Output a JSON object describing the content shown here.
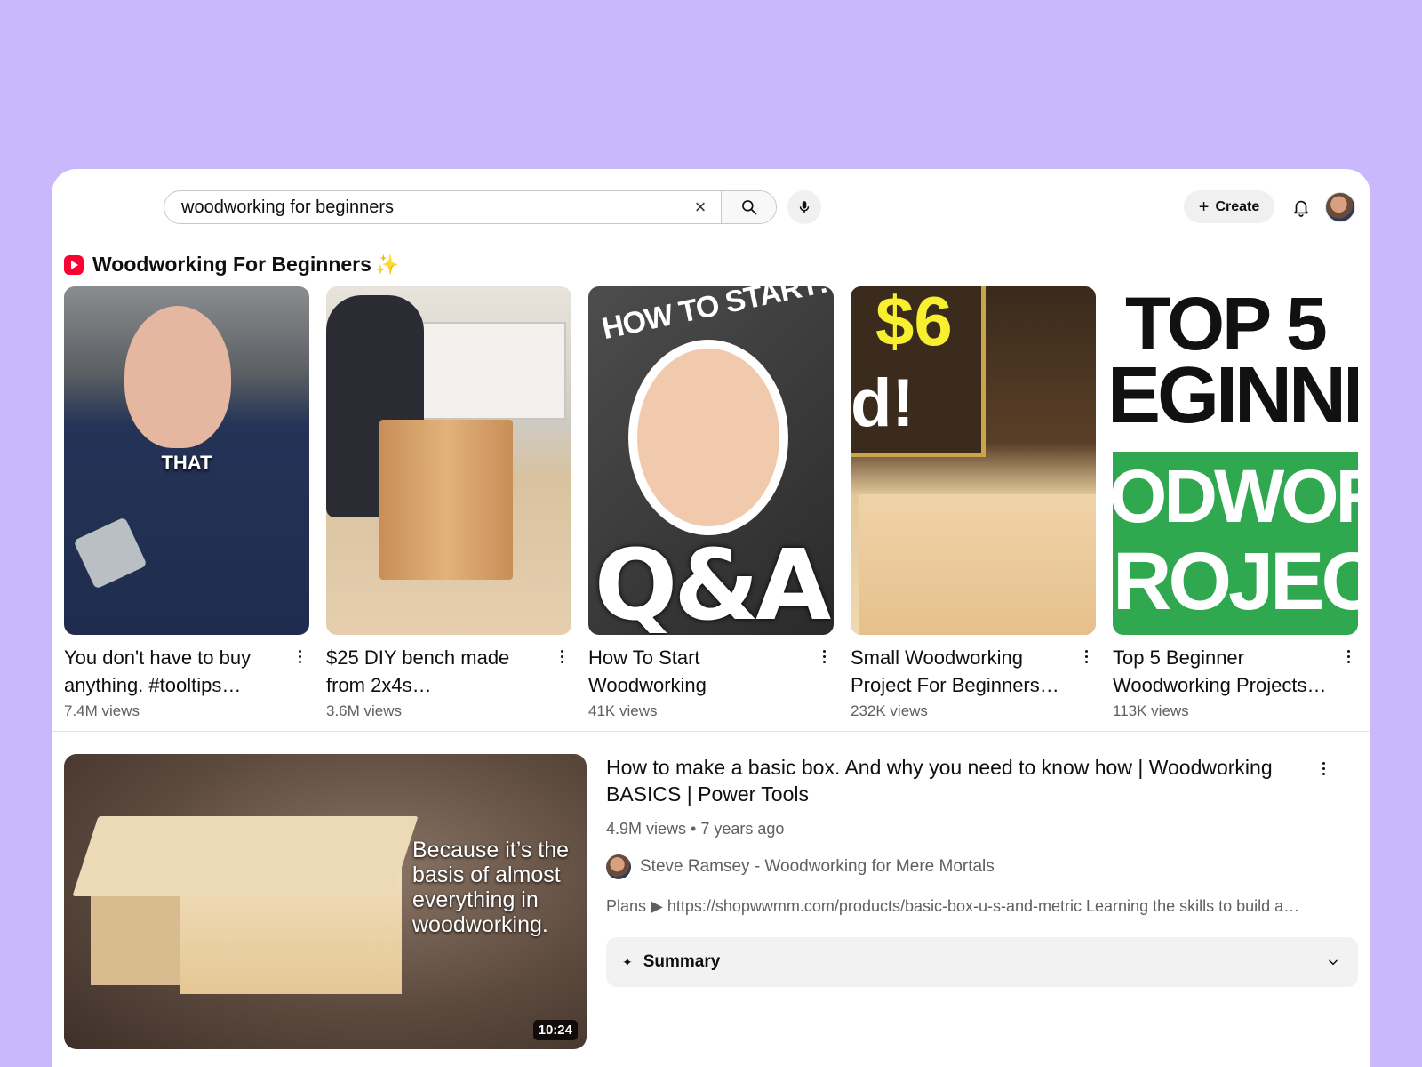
{
  "search": {
    "query": "woodworking for beginners",
    "clear_glyph": "×"
  },
  "header": {
    "create_label": "Create",
    "create_glyph": "+"
  },
  "shorts_section": {
    "title": "Woodworking For Beginners",
    "sparkle": "✨",
    "items": [
      {
        "title": "You don't have to buy anything. #tooltips…",
        "views": "7.4M views",
        "thumb_text": "THAT"
      },
      {
        "title": "$25 DIY bench made from 2x4s…",
        "views": "3.6M views"
      },
      {
        "title": "How To Start Woodworking",
        "views": "41K views",
        "thumb_text": "HOW TO START!",
        "thumb_text_2": "Q&A"
      },
      {
        "title": "Small Woodworking Project For Beginners ~…",
        "views": "232K views",
        "thumb_text": "$6",
        "thumb_text_2": "d!"
      },
      {
        "title": "Top 5 Beginner Woodworking Projects…",
        "views": "113K views",
        "thumb_text": "TOP 5",
        "thumb_text_2": "EGINNI",
        "thumb_text_3": "ODWORK",
        "thumb_text_4": "ROJECTS"
      }
    ]
  },
  "video": {
    "title": "How to make a basic box. And why you need to know how | Woodworking BASICS | Power Tools",
    "meta": "4.9M views • 7 years ago",
    "channel": "Steve Ramsey - Woodworking for Mere Mortals",
    "description": "Plans ▶ https://shopwwmm.com/products/basic-box-u-s-and-metric Learning the skills to build a…",
    "thumb_caption": "Because it’s the basis of almost everything in woodworking.",
    "duration": "10:24",
    "summary_label": "Summary",
    "summary_sparkle": "✦"
  },
  "colors": {
    "background": "#c9b8fb",
    "brand_red": "#ff0033",
    "secondary_text": "#606060"
  }
}
